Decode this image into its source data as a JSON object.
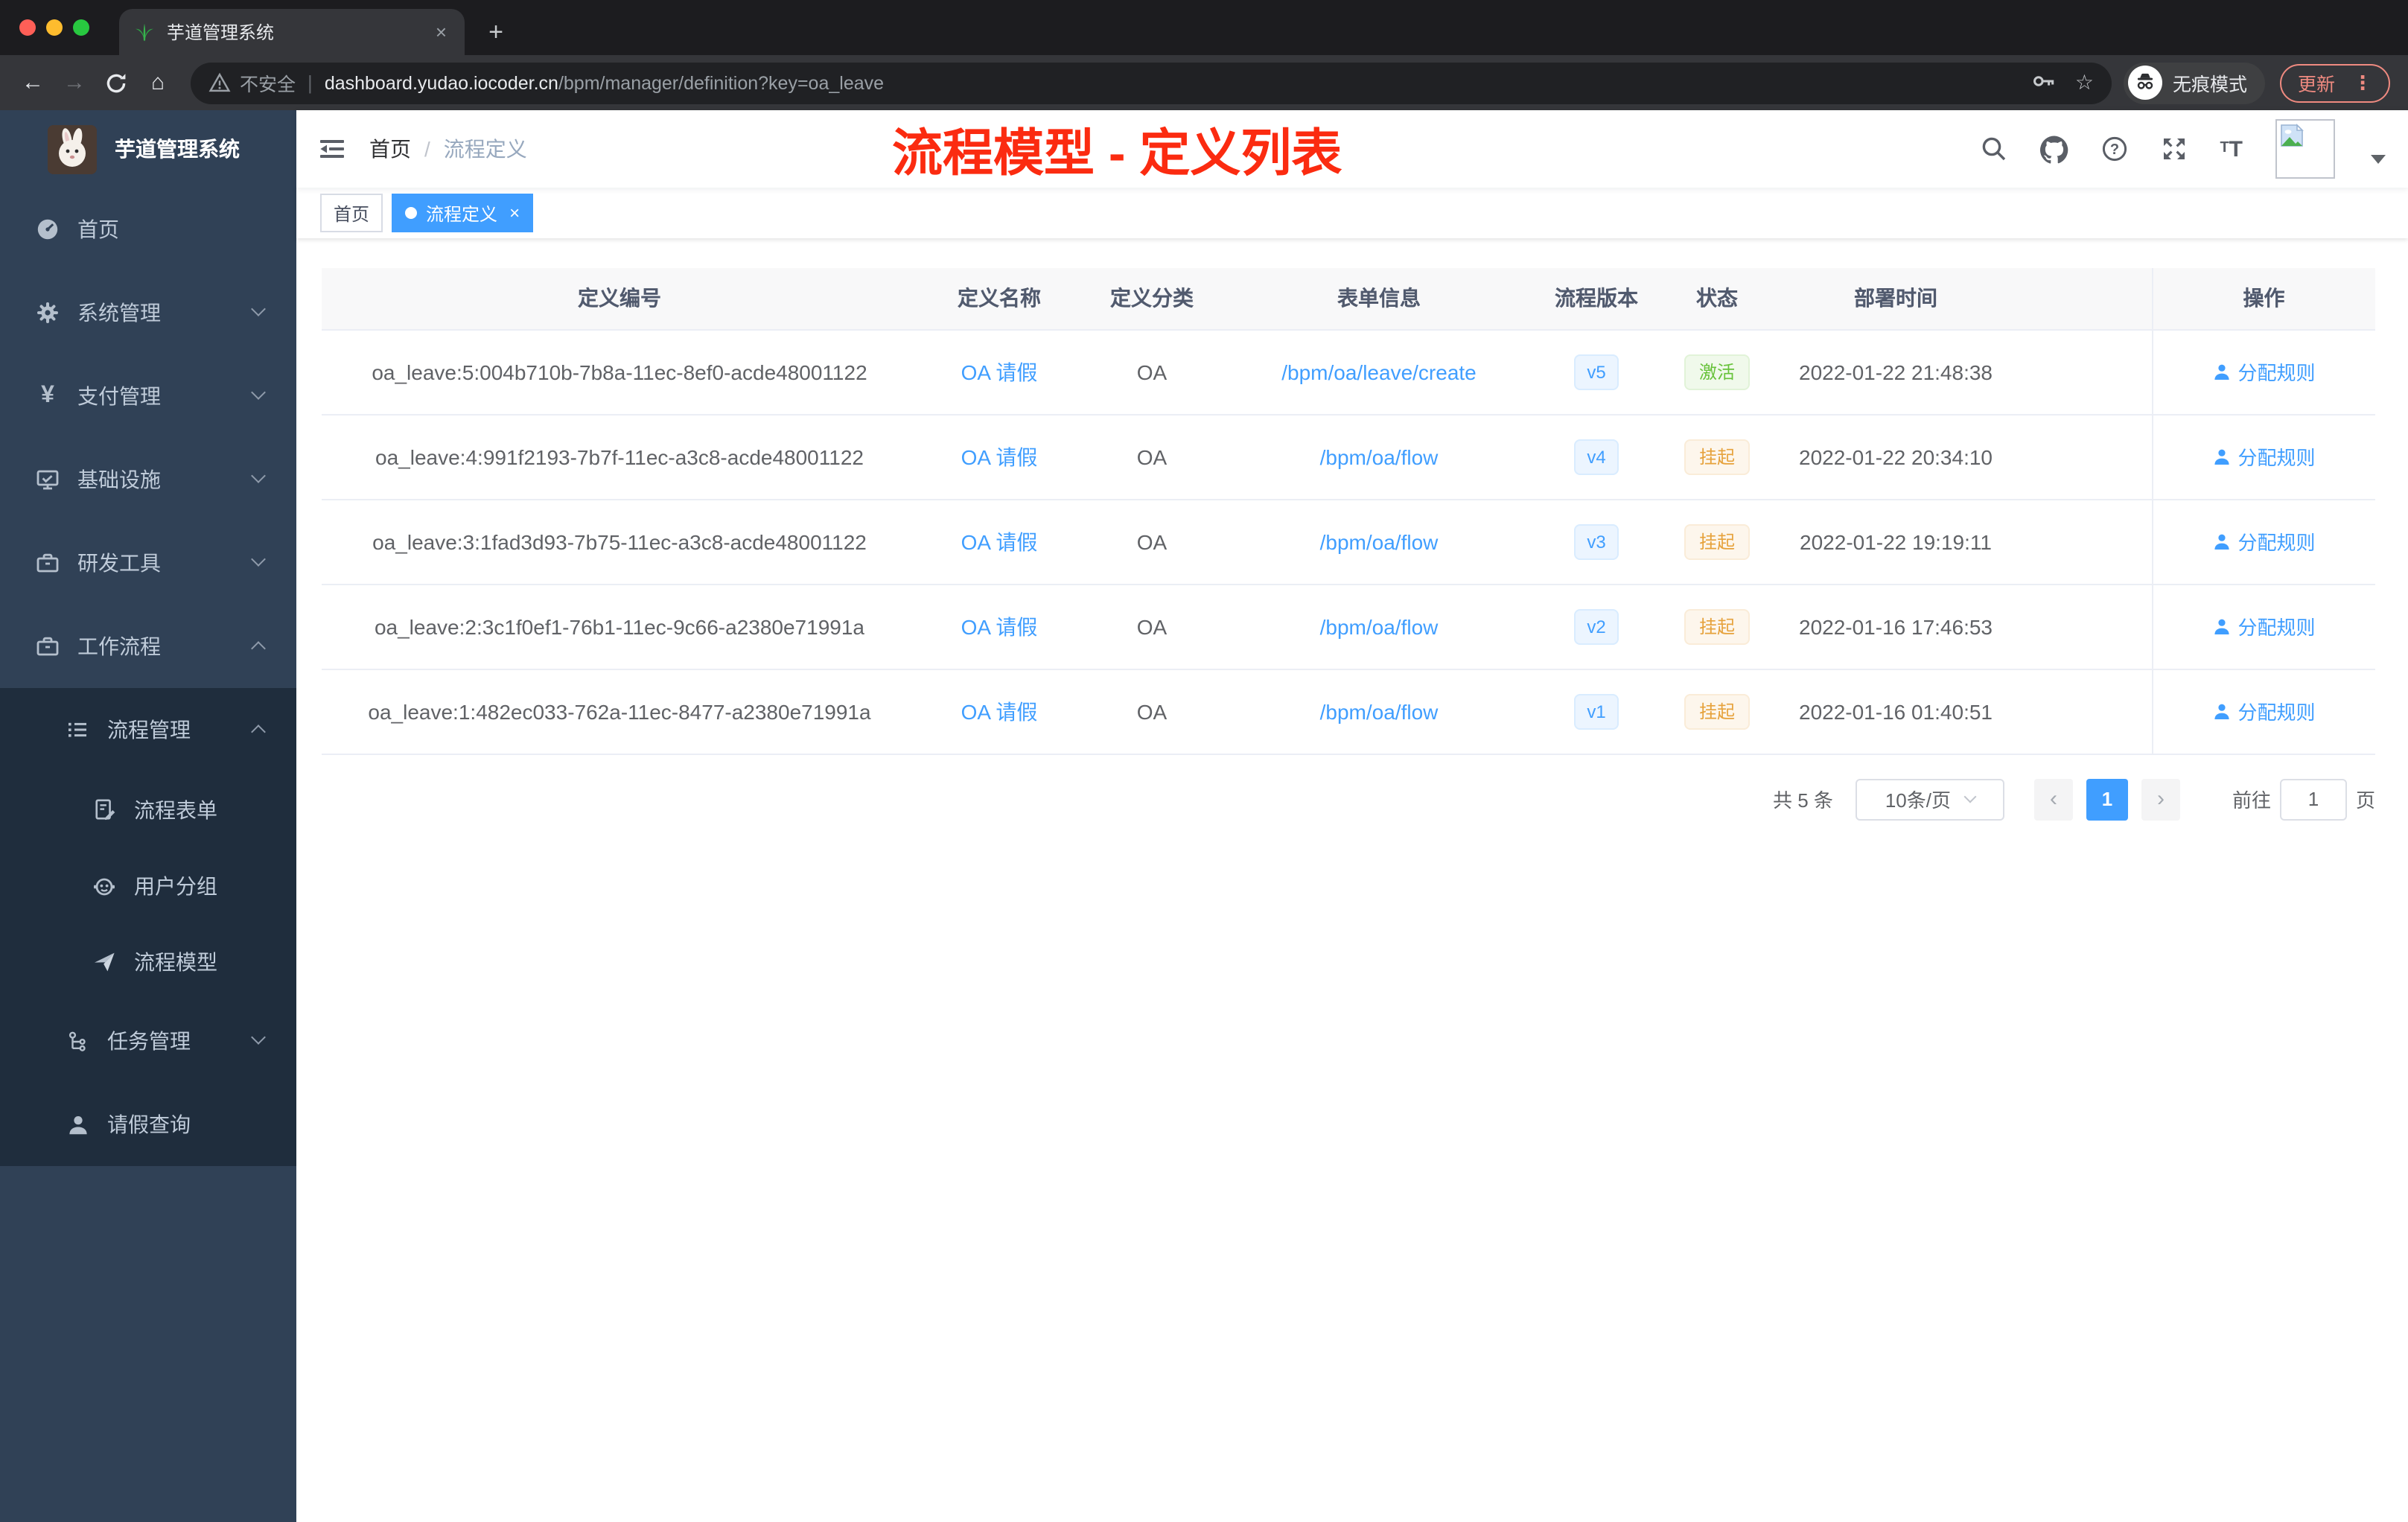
{
  "browser": {
    "tab": {
      "title": "芋道管理系统",
      "close_glyph": "×"
    },
    "new_tab_glyph": "+",
    "nav": {
      "back_glyph": "←",
      "forward_glyph": "→",
      "home_glyph": "⌂"
    },
    "url": {
      "warning": "不安全",
      "domain": "dashboard.yudao.iocoder.cn",
      "path": "/bpm/manager/definition?key=oa_leave"
    },
    "star_glyph": "☆",
    "incognito_label": "无痕模式",
    "update_label": "更新",
    "menu_glyph": "⋮"
  },
  "sidebar": {
    "app_title": "芋道管理系统",
    "items": [
      {
        "label": "首页"
      },
      {
        "label": "系统管理"
      },
      {
        "label": "支付管理"
      },
      {
        "label": "基础设施"
      },
      {
        "label": "研发工具"
      },
      {
        "label": "工作流程"
      },
      {
        "label": "流程管理"
      },
      {
        "label": "流程表单"
      },
      {
        "label": "用户分组"
      },
      {
        "label": "流程模型"
      },
      {
        "label": "任务管理"
      },
      {
        "label": "请假查询"
      }
    ]
  },
  "navbar": {
    "breadcrumb": {
      "home": "首页",
      "separator": "/",
      "current": "流程定义"
    },
    "annotation": {
      "text": "流程模型 - 定义列表",
      "color": "#fb2b10"
    }
  },
  "tags": {
    "close_glyph": "×",
    "items": [
      {
        "label": "首页",
        "active": false
      },
      {
        "label": "流程定义",
        "active": true
      }
    ]
  },
  "table": {
    "columns": [
      "定义编号",
      "定义名称",
      "定义分类",
      "表单信息",
      "流程版本",
      "状态",
      "部署时间",
      "操作"
    ],
    "action_label": "分配规则",
    "rows": [
      {
        "id": "oa_leave:5:004b710b-7b8a-11ec-8ef0-acde48001122",
        "name": "OA 请假",
        "category": "OA",
        "form": "/bpm/oa/leave/create",
        "version": "v5",
        "status": "激活",
        "time": "2022-01-22 21:48:38"
      },
      {
        "id": "oa_leave:4:991f2193-7b7f-11ec-a3c8-acde48001122",
        "name": "OA 请假",
        "category": "OA",
        "form": "/bpm/oa/flow",
        "version": "v4",
        "status": "挂起",
        "time": "2022-01-22 20:34:10"
      },
      {
        "id": "oa_leave:3:1fad3d93-7b75-11ec-a3c8-acde48001122",
        "name": "OA 请假",
        "category": "OA",
        "form": "/bpm/oa/flow",
        "version": "v3",
        "status": "挂起",
        "time": "2022-01-22 19:19:11"
      },
      {
        "id": "oa_leave:2:3c1f0ef1-76b1-11ec-9c66-a2380e71991a",
        "name": "OA 请假",
        "category": "OA",
        "form": "/bpm/oa/flow",
        "version": "v2",
        "status": "挂起",
        "time": "2022-01-16 17:46:53"
      },
      {
        "id": "oa_leave:1:482ec033-762a-11ec-8477-a2380e71991a",
        "name": "OA 请假",
        "category": "OA",
        "form": "/bpm/oa/flow",
        "version": "v1",
        "status": "挂起",
        "time": "2022-01-16 01:40:51"
      }
    ]
  },
  "pagination": {
    "total": "共 5 条",
    "page_size": "10条/页",
    "prev_glyph": "‹",
    "next_glyph": "›",
    "current_page": "1",
    "goto_label": "前往",
    "goto_value": "1",
    "page_unit": "页"
  },
  "colors": {
    "primary": "#409eff",
    "annotation_red": "#fb2b10",
    "sidebar_bg": "#304156",
    "submenu_bg": "#1f2d3d",
    "status_active_green": "#67c23a",
    "status_suspended_orange": "#e6a23c"
  }
}
